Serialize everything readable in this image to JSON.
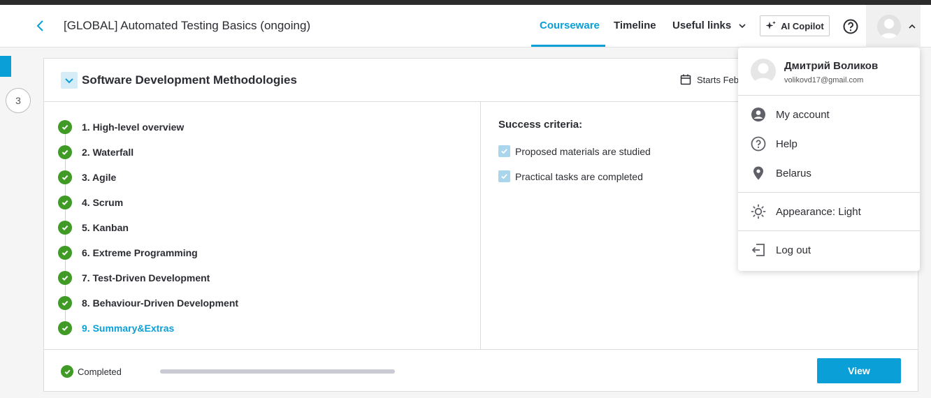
{
  "header": {
    "course_title": "[GLOBAL] Automated Testing Basics (ongoing)",
    "nav": {
      "courseware": "Courseware",
      "timeline": "Timeline",
      "useful_links": "Useful links"
    },
    "copilot_label": "AI Copilot"
  },
  "sidebar": {
    "step_number": "3"
  },
  "module": {
    "title": "Software Development Methodologies",
    "starts_label": "Starts Feb",
    "lessons": [
      "1. High-level overview",
      "2. Waterfall",
      "3. Agile",
      "4. Scrum",
      "5. Kanban",
      "6. Extreme Programming",
      "7. Test-Driven Development",
      "8. Behaviour-Driven Development",
      "9. Summary&Extras"
    ],
    "success_criteria_title": "Success criteria:",
    "criteria": [
      "Proposed materials are studied",
      "Practical tasks are completed"
    ],
    "status_label": "Completed",
    "progress": 1.0,
    "view_label": "View"
  },
  "user_menu": {
    "name": "Дмитрий Воликов",
    "email": "volikovd17@gmail.com",
    "my_account": "My account",
    "help": "Help",
    "location": "Belarus",
    "appearance": "Appearance: Light",
    "logout": "Log out"
  },
  "colors": {
    "accent": "#0a9fd6",
    "success": "#3f9b26"
  }
}
